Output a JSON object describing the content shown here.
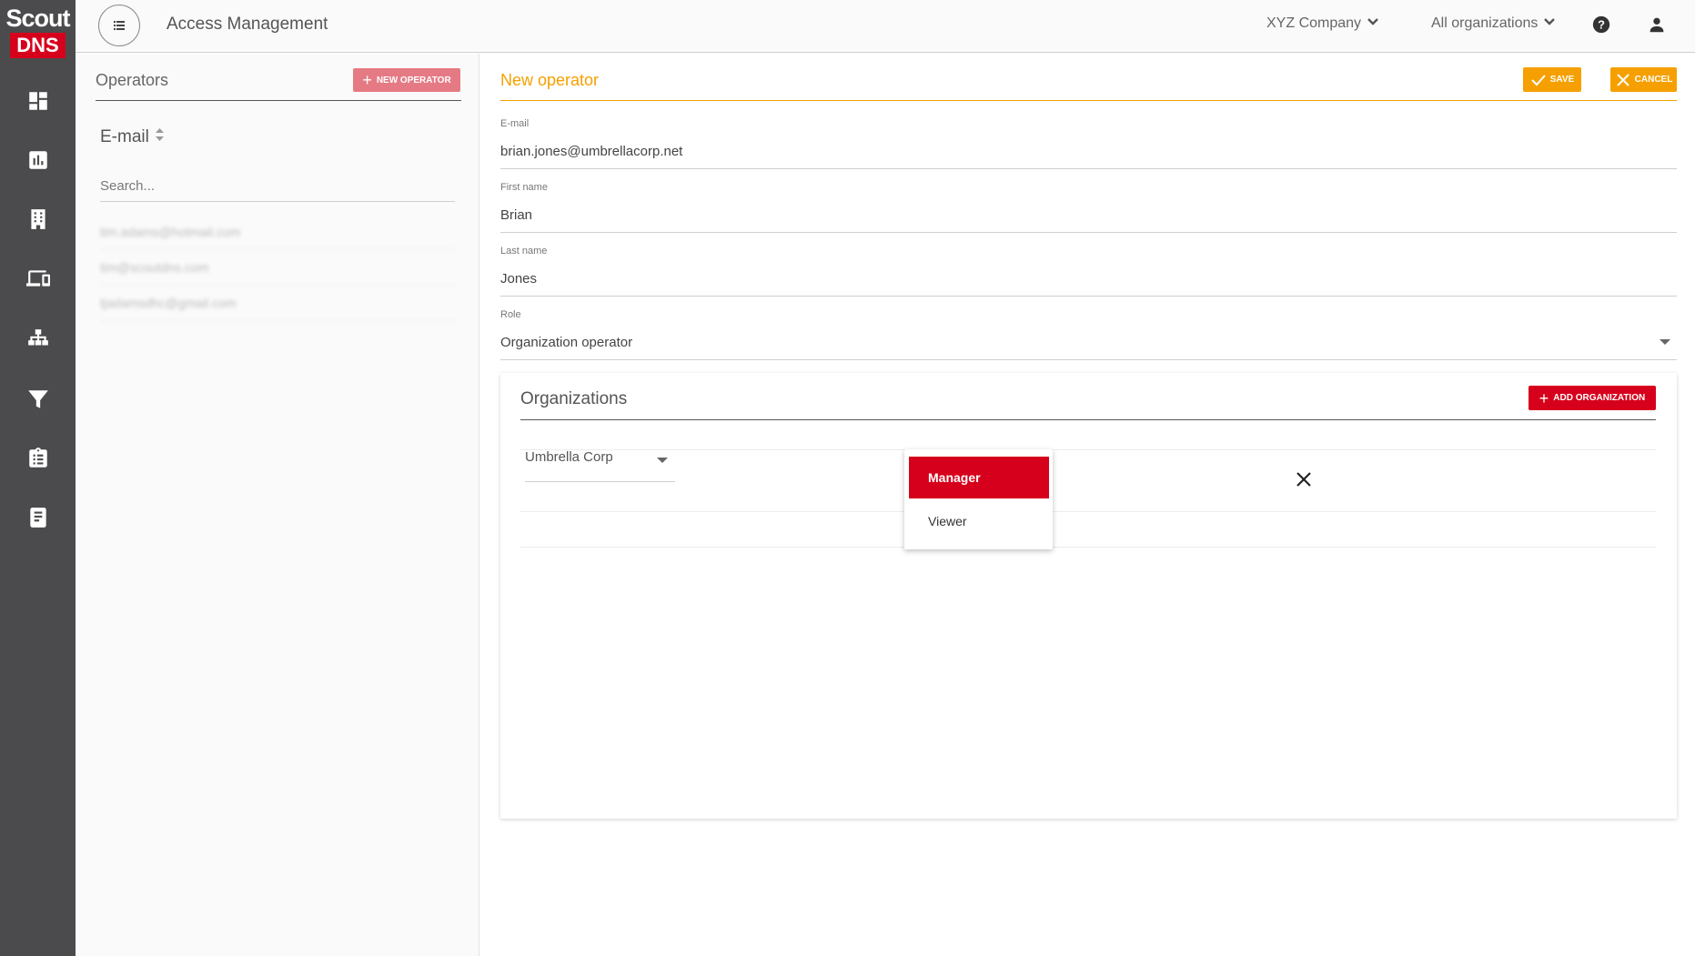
{
  "brand": {
    "logo_top": "Scout",
    "logo_bottom": "DNS"
  },
  "sidebar": {
    "items": [
      {
        "name": "dashboard",
        "icon": "dashboard-icon"
      },
      {
        "name": "reports",
        "icon": "bar-chart-icon"
      },
      {
        "name": "organizations",
        "icon": "building-icon"
      },
      {
        "name": "devices",
        "icon": "devices-icon"
      },
      {
        "name": "hierarchy",
        "icon": "sitemap-icon"
      },
      {
        "name": "filters",
        "icon": "filter-icon"
      },
      {
        "name": "policies",
        "icon": "clipboard-list-icon"
      },
      {
        "name": "docs",
        "icon": "book-icon"
      }
    ]
  },
  "header": {
    "title": "Access Management",
    "company": "XYZ Company",
    "organizations": "All organizations"
  },
  "operators": {
    "title": "Operators",
    "new_button": "NEW OPERATOR",
    "sort_label": "E-mail",
    "search_placeholder": "Search...",
    "rows": [
      "tim.adams@hotmail.com",
      "tim@scoutdns.com",
      "tjadamsdhc@gmail.com"
    ]
  },
  "form": {
    "title": "New operator",
    "save_label": "SAVE",
    "cancel_label": "CANCEL",
    "email_label": "E-mail",
    "email_value": "brian.jones@umbrellacorp.net",
    "first_name_label": "First name",
    "first_name_value": "Brian",
    "last_name_label": "Last name",
    "last_name_value": "Jones",
    "role_label": "Role",
    "role_value": "Organization operator"
  },
  "organizations_card": {
    "title": "Organizations",
    "add_button": "ADD ORGANIZATION",
    "org_value": "Umbrella Corp",
    "permission_options": [
      "Manager",
      "Viewer"
    ],
    "selected_permission": "Manager"
  },
  "colors": {
    "accent": "#f5a000",
    "brand_red": "#d6001c",
    "sidebar_bg": "#4b4b4d",
    "new_operator_btn": "#e57a84"
  }
}
